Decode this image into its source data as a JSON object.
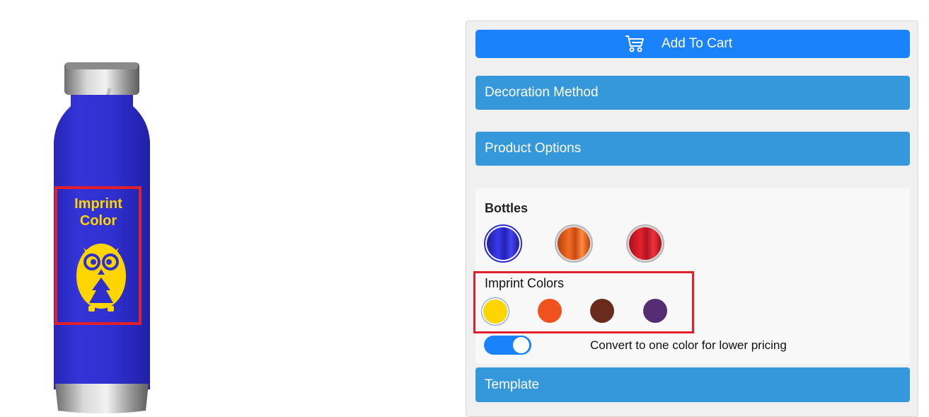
{
  "preview": {
    "imprint_line1": "Imprint",
    "imprint_line2": "Color",
    "bottle_color": "#2f2fcc",
    "imprint_color": "#ffd500",
    "highlight_color": "#e0202c"
  },
  "panel": {
    "add_to_cart_label": "Add To Cart",
    "cart_icon": "shopping-cart-icon",
    "accordions": {
      "decoration": "Decoration Method",
      "options": "Product Options",
      "template": "Template"
    },
    "bottles": {
      "title": "Bottles",
      "swatches": [
        {
          "name": "blue",
          "selected": true
        },
        {
          "name": "orange",
          "selected": false
        },
        {
          "name": "red",
          "selected": false
        }
      ]
    },
    "imprint_colors": {
      "title": "Imprint Colors",
      "colors": [
        {
          "hex": "#ffd500",
          "selected": true
        },
        {
          "hex": "#f0521e",
          "selected": false
        },
        {
          "hex": "#6a2b1d",
          "selected": false
        },
        {
          "hex": "#562d75",
          "selected": false
        }
      ]
    },
    "toggle": {
      "label": "Convert to one color for lower pricing",
      "on": true
    }
  }
}
